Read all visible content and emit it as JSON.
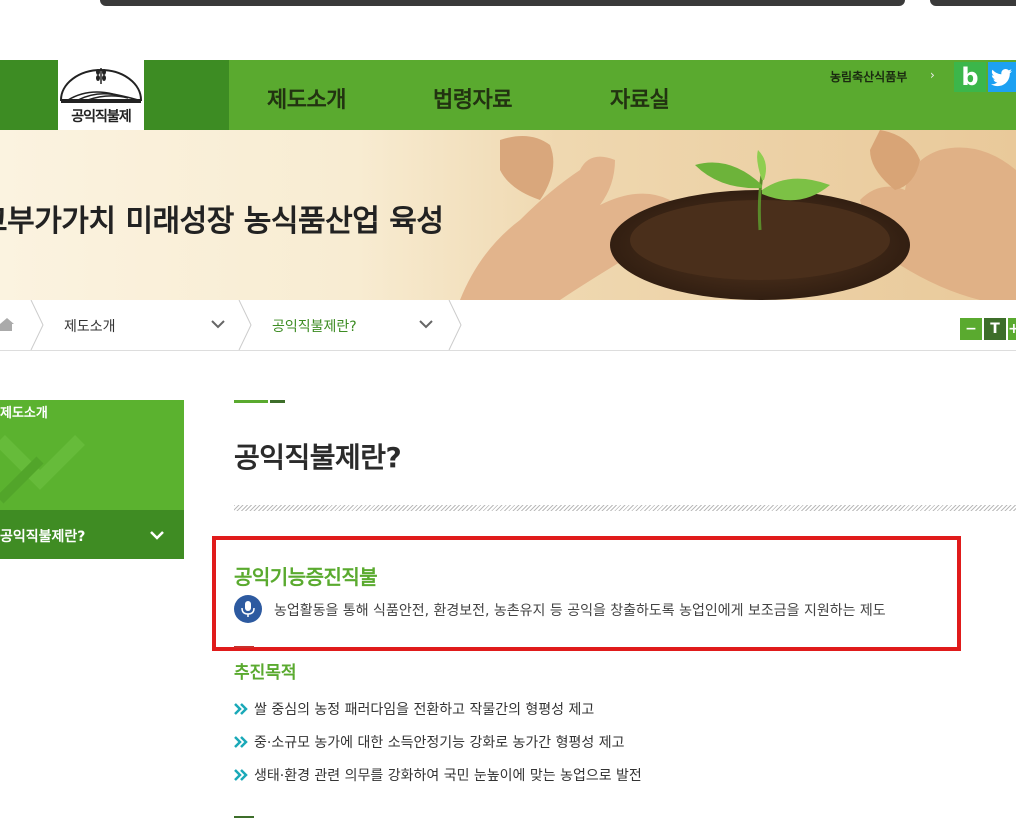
{
  "header": {
    "logo_text": "공익직불제",
    "menu": [
      "제도소개",
      "법령자료",
      "자료실"
    ],
    "ministry_link": "농림축산식품부",
    "ministry_arrow": "›",
    "sns_blog": "b"
  },
  "hero": {
    "title": "고부가가치 미래성장 농식품산업 육성"
  },
  "breadcrumb": {
    "items": [
      "제도소개",
      "공익직불제란?"
    ]
  },
  "font_controls": [
    "−",
    "T",
    "+"
  ],
  "sidebar": {
    "heading": "제도소개",
    "active_item": "공익직불제란?"
  },
  "main": {
    "page_title": "공익직불제란?",
    "section_title": "공익기능증진직불",
    "section_desc": "농업활동을 통해 식품안전, 환경보전, 농촌유지 등 공익을 창출하도록 농업인에게 보조금을 지원하는 제도",
    "goal_title": "추진목적",
    "goals": [
      "쌀 중심의 농정 패러다임을 전환하고 작물간의 형평성 제고",
      "중·소규모 농가에 대한 소득안정기능 강화로 농가간 형평성 제고",
      "생태·환경 관련 의무를 강화하여 국민 눈높이에 맞는 농업으로 발전"
    ]
  },
  "colors": {
    "brand_green": "#5aaa2f",
    "dark_green": "#3d8c23",
    "highlight_red": "#e01b1b",
    "mic_blue": "#2d5aa0",
    "bullet_teal": "#1aa9b8"
  }
}
